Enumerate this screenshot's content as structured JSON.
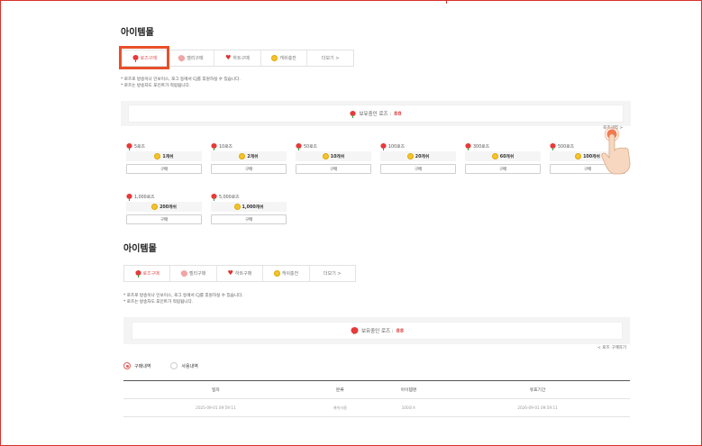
{
  "section1": {
    "title": "아이템몰",
    "tabs": [
      {
        "label": "로즈구매",
        "icon": "rose-icon"
      },
      {
        "label": "젤리구매",
        "icon": "jelly-icon"
      },
      {
        "label": "하트구매",
        "icon": "heart-icon"
      },
      {
        "label": "캐쉬충전",
        "icon": "coin-icon"
      },
      {
        "label": "더보기 >",
        "icon": ""
      }
    ],
    "notes": [
      "* 로즈로 방송이나 인보이스, 로그 등에서 CJ를 후원하실 수 있습니다.",
      "* 로즈는 방송자도 포인트가 적립됩니다."
    ],
    "balance_label": "보유중인 로즈 :",
    "balance_value": "88",
    "history_link": "로즈내역 >",
    "items": [
      {
        "label": "5로즈",
        "price": "1캐쉬",
        "button": "구매"
      },
      {
        "label": "10로즈",
        "price": "2캐쉬",
        "button": "구매"
      },
      {
        "label": "50로즈",
        "price": "10캐쉬",
        "button": "구매"
      },
      {
        "label": "100로즈",
        "price": "20캐쉬",
        "button": "구매"
      },
      {
        "label": "300로즈",
        "price": "60캐쉬",
        "button": "구매"
      },
      {
        "label": "500로즈",
        "price": "100캐쉬",
        "button": "구매"
      },
      {
        "label": "1,000로즈",
        "price": "200캐쉬",
        "button": "구매"
      },
      {
        "label": "5,000로즈",
        "price": "1,000캐쉬",
        "button": "구매"
      }
    ]
  },
  "section2": {
    "title": "아이템몰",
    "tabs": [
      {
        "label": "로즈구매",
        "icon": "rose-icon"
      },
      {
        "label": "젤리구매",
        "icon": "jelly-icon"
      },
      {
        "label": "하트구매",
        "icon": "heart-icon"
      },
      {
        "label": "캐쉬충전",
        "icon": "coin-icon"
      },
      {
        "label": "더보기 >",
        "icon": ""
      }
    ],
    "notes": [
      "* 로즈로 방송이나 인보이스, 로그 등에서 CJ를 후원하실 수 있습니다.",
      "* 로즈는 방송자도 포인트가 적립됩니다."
    ],
    "balance_label": "보유중인 로즈 :",
    "balance_value": "88",
    "back_link": "< 로즈 구매하기",
    "radios": [
      {
        "label": "구매내역",
        "selected": true
      },
      {
        "label": "사용내역",
        "selected": false
      }
    ],
    "table": {
      "headers": [
        "일자",
        "분류",
        "아이템명",
        "유효기간"
      ],
      "rows": [
        [
          "2025-09-01 09:59:11",
          "캐쉬사용",
          "100로즈",
          "2026-09-01 09:59:11"
        ]
      ]
    }
  },
  "colors": {
    "accent": "#e05050",
    "highlight": "#e8502a",
    "coin": "#f4c430"
  }
}
